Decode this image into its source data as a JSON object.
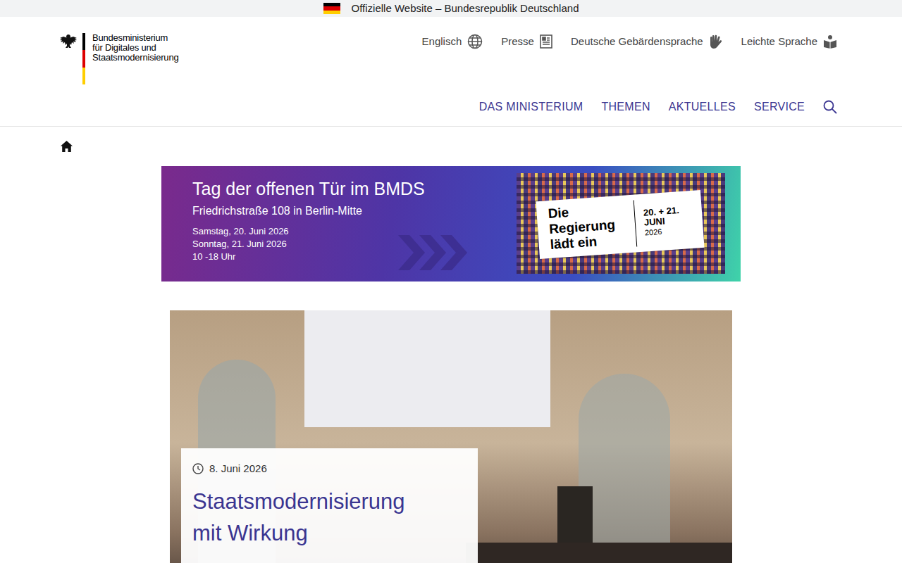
{
  "official_bar": {
    "text": "Offizielle Website – Bundesrepublik Deutschland"
  },
  "logo": {
    "lines": [
      "Bundesministerium",
      "für Digitales und",
      "Staatsmodernisierung"
    ]
  },
  "service_links": [
    {
      "label": "Englisch",
      "kind": "globe"
    },
    {
      "label": "Presse",
      "kind": "press"
    },
    {
      "label": "Deutsche Gebärdensprache",
      "kind": "sign"
    },
    {
      "label": "Leichte Sprache",
      "kind": "easy"
    }
  ],
  "nav": [
    "DAS MINISTERIUM",
    "THEMEN",
    "AKTUELLES",
    "SERVICE"
  ],
  "banner": {
    "title": "Tag der offenen Tür im BMDS",
    "subtitle": "Friedrichstraße 108 in Berlin-Mitte",
    "dates": [
      "Samstag, 20. Juni 2026",
      "Sonntag, 21. Juni 2026",
      "10 -18 Uhr"
    ],
    "label": "Die Regierung lädt ein",
    "label_dates": [
      "20. + 21.",
      "JUNI",
      "2026"
    ]
  },
  "hero": {
    "date": "8. Juni 2026",
    "title": "Staatsmodernisierung mit Wirkung"
  }
}
